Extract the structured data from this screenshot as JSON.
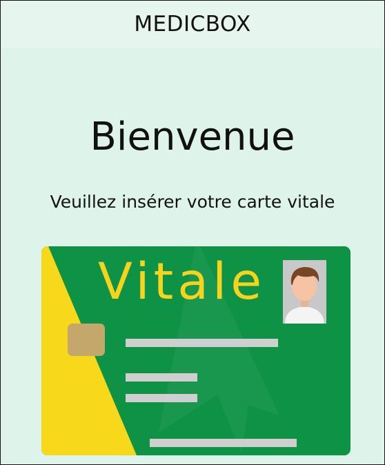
{
  "header": {
    "title": "MEDICBOX"
  },
  "main": {
    "welcome": "Bienvenue",
    "instruction": "Veuillez insérer votre carte vitale"
  },
  "card": {
    "brand_text": "Vitale",
    "icons": [
      "chip-icon",
      "id-photo-icon"
    ],
    "colors": {
      "card_green": "#0e9246",
      "card_yellow": "#f8d81a",
      "chip_gold": "#c4a76a",
      "text_lines": "#cfcfcf"
    }
  },
  "colors": {
    "background": "#def3e9",
    "header_background": "#e6f5ee"
  }
}
